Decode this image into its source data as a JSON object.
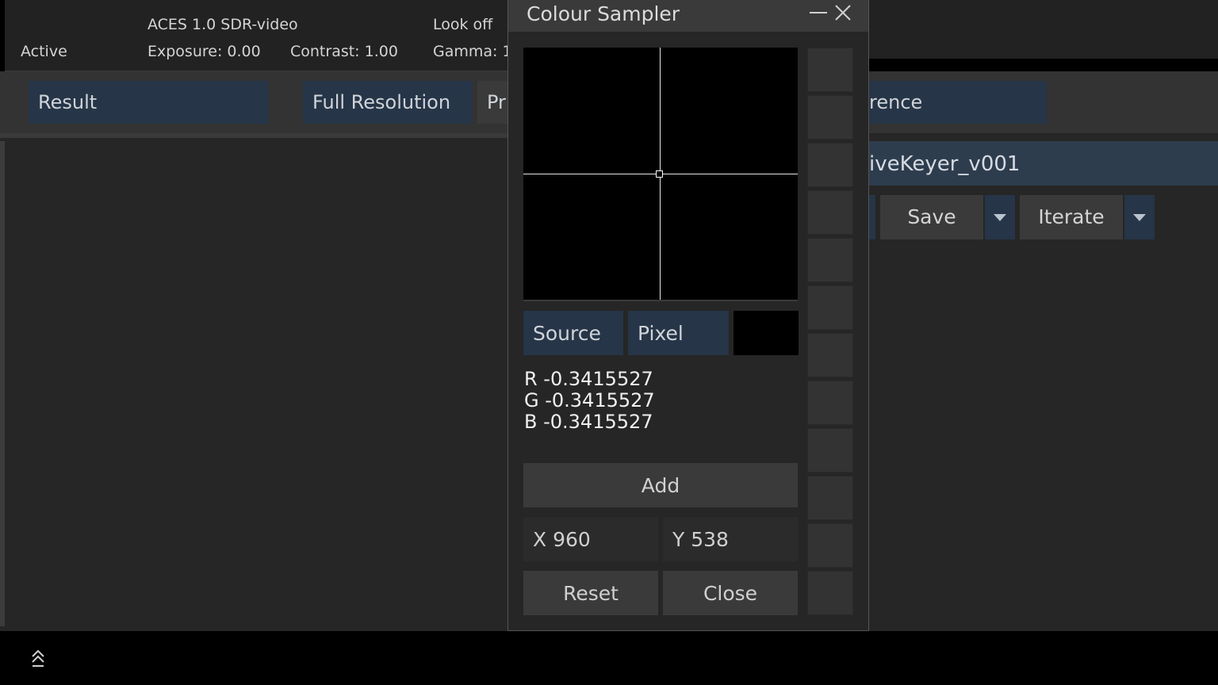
{
  "topbar": {
    "status": "Active",
    "display_transform": "ACES 1.0 SDR-video",
    "look": "Look off",
    "exposure": "Exposure: 0.00",
    "contrast": "Contrast: 1.00",
    "gamma": "Gamma: 1."
  },
  "viewbar": {
    "result": "Result",
    "resolution": "Full Resolution",
    "partial": "Pr",
    "reference": "rence"
  },
  "right_panel": {
    "node_name": "iveKeyer_v001",
    "save_label": "Save",
    "iterate_label": "Iterate"
  },
  "dialog": {
    "title": "Colour Sampler",
    "source_label": "Source",
    "pixel_label": "Pixel",
    "r_value": "R -0.3415527",
    "g_value": "G -0.3415527",
    "b_value": "B -0.3415527",
    "add_label": "Add",
    "x_value": "X 960",
    "y_value": "Y 538",
    "reset_label": "Reset",
    "close_label": "Close",
    "preview_color": "#000000"
  },
  "colors": {
    "accent_blue": "#263547",
    "panel": "#262626",
    "button": "#3a3a3a"
  }
}
